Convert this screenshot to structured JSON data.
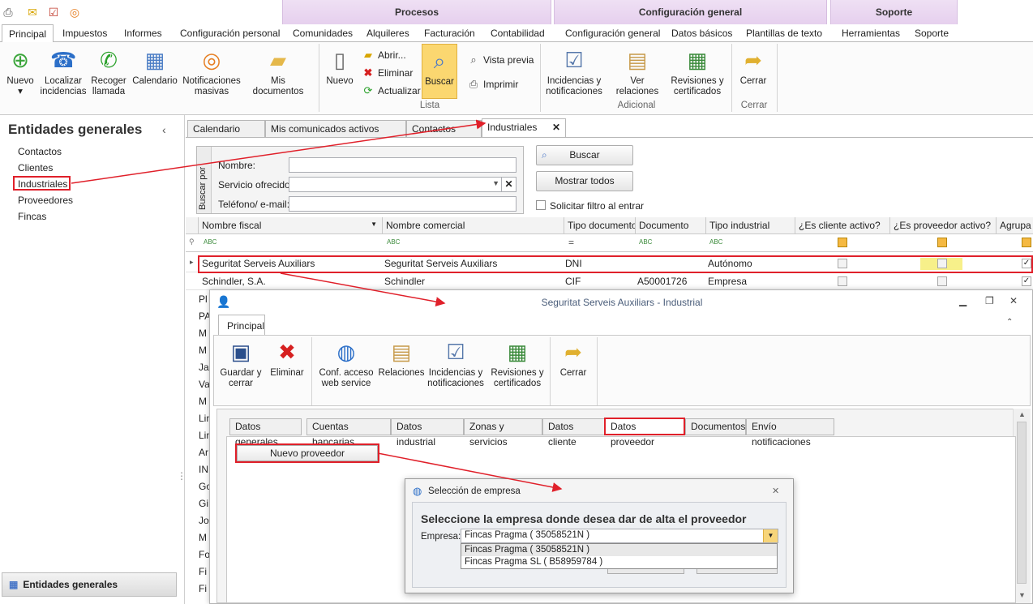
{
  "ribbon": {
    "context_groups": [
      "Procesos",
      "Configuración general",
      "Soporte"
    ],
    "tabs": [
      "Principal",
      "Impuestos",
      "Informes",
      "Configuración personal",
      "Comunidades",
      "Alquileres",
      "Facturación",
      "Contabilidad",
      "Configuración general",
      "Datos básicos",
      "Plantillas de texto",
      "Herramientas",
      "Soporte"
    ],
    "buttons": {
      "nuevo": "Nuevo",
      "localizar": "Localizar incidencias",
      "recoger": "Recoger llamada",
      "calendario": "Calendario",
      "notificaciones": "Notificaciones masivas",
      "documentos": "Mis documentos",
      "nuevo2": "Nuevo",
      "abrir": "Abrir...",
      "eliminar": "Eliminar",
      "actualizar": "Actualizar",
      "buscar": "Buscar",
      "vista_previa": "Vista previa",
      "imprimir": "Imprimir",
      "incidencias": "Incidencias y notificaciones",
      "relaciones": "Ver relaciones",
      "revisiones": "Revisiones y certificados",
      "cerrar": "Cerrar"
    },
    "groups": {
      "lista": "Lista",
      "adicional": "Adicional",
      "cerrar": "Cerrar"
    }
  },
  "sidebar": {
    "title": "Entidades generales",
    "items": [
      "Contactos",
      "Clientes",
      "Industriales",
      "Proveedores",
      "Fincas"
    ],
    "footer": "Entidades generales"
  },
  "doc_tabs": [
    "Calendario",
    "Mis comunicados activos",
    "Contactos",
    "Industriales"
  ],
  "search": {
    "side_label": "Buscar por",
    "nombre_label": "Nombre:",
    "servicio_label": "Servicio ofrecido:",
    "telefono_label": "Teléfono/ e-mail:",
    "buscar_btn": "Buscar",
    "mostrar_btn": "Mostrar todos",
    "solicitar": "Solicitar filtro al entrar"
  },
  "grid": {
    "columns": [
      "Nombre fiscal",
      "Nombre comercial",
      "Tipo documento",
      "Documento",
      "Tipo industrial",
      "¿Es cliente activo?",
      "¿Es proveedor activo?",
      "Agrupa p"
    ],
    "rows": [
      {
        "fiscal": "Seguritat Serveis Auxiliars",
        "comercial": "Seguritat Serveis Auxiliars",
        "tipo": "DNI",
        "doc": "",
        "industrial": "Autónomo"
      },
      {
        "fiscal": "Schindler, S.A.",
        "comercial": "Schindler",
        "tipo": "CIF",
        "doc": "A50001726",
        "industrial": "Empresa"
      }
    ],
    "hidden_rows": [
      "Pl",
      "PA",
      "M",
      "M",
      "Ja",
      "Va",
      "M",
      "Lin",
      "Lin",
      "Ar",
      "IN",
      "Go",
      "Gi",
      "Jo",
      "M",
      "Fo",
      "Fi",
      "Fi",
      "Fi"
    ]
  },
  "window": {
    "title": "Seguritat Serveis Auxiliars - Industrial",
    "tab": "Principal",
    "buttons": {
      "guardar": "Guardar y cerrar",
      "eliminar": "Eliminar",
      "conf": "Conf. acceso web service",
      "relaciones": "Relaciones",
      "incidencias": "Incidencias y notificaciones",
      "revisiones": "Revisiones y certificados",
      "cerrar": "Cerrar"
    },
    "tabs": [
      "Datos generales",
      "Cuentas bancarias",
      "Datos industrial",
      "Zonas y servicios",
      "Datos cliente",
      "Datos proveedor",
      "Documentos",
      "Envío notificaciones"
    ],
    "nuevo_proveedor": "Nuevo proveedor"
  },
  "dialog": {
    "title": "Selección de empresa",
    "heading": "Seleccione la empresa donde desea dar de alta el proveedor",
    "label": "Empresa:",
    "selected": "Fincas Pragma ( 35058521N )",
    "options": [
      "Fincas Pragma ( 35058521N )",
      "Fincas Pragma SL ( B58959784 )"
    ]
  },
  "colors": {
    "accent": "#e0202a",
    "context": "#e6d0ee",
    "highlight": "#f7f08a"
  }
}
